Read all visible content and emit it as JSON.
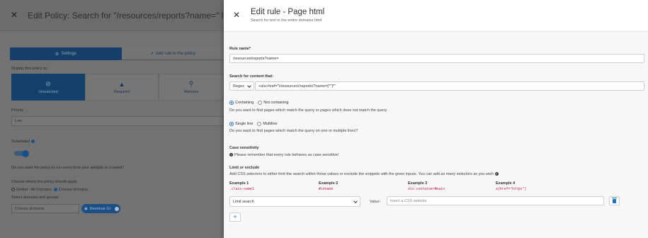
{
  "background": {
    "title": "Edit Policy: Search for \"/resources/reports?name=\" link",
    "tabs": {
      "settings": "Settings",
      "add_rule": "Add rule to the policy"
    },
    "display_label": "Display this policy as",
    "display_options": [
      "Unwatched",
      "Required",
      "Matches"
    ],
    "priority_label": "Priority",
    "priority_value": "Low",
    "scheduled_label": "Scheduled",
    "scheduled_help": "Do you want the policy to run every time your website is crawled?",
    "where_label": "Choose where the policy should apply",
    "where_options": [
      "Global - All Domains",
      "Choose domains"
    ],
    "domains_label": "Select domains and groups",
    "domains_placeholder": "Choose domains",
    "chip_label": "Revenue Gr"
  },
  "drawer": {
    "title": "Edit rule - Page html",
    "subtitle": "Search for text in the entire domains html",
    "rule_name_label": "Rule name*",
    "rule_name_value": "/resources/reports?name=",
    "search_label": "Search for content that:",
    "search_mode": "Regex",
    "search_value": "<a\\s+href=\"\\/resources\\/reports\\?name=[^\"]*\"",
    "contain_options": [
      "Containing",
      "Not containing"
    ],
    "contain_help": "Do you want to find pages which match the query or pages which does not match the query",
    "line_options": [
      "Single line",
      "Multiline"
    ],
    "line_help": "Do you want to find pages which match the query on one or multiple lines?",
    "case_label": "Case sensitivity",
    "case_note": "Please remember that every rule behaves as case-sensitive!",
    "limit_label": "Limit or exclude",
    "limit_help": "Add CSS selectors to either limit the search within those values or exclude the snippets with the given inputs. You can add as many selectors as you wish",
    "examples": [
      {
        "title": "Example 1",
        "code": ".class-name1"
      },
      {
        "title": "Example 2",
        "code": "#idname"
      },
      {
        "title": "Example 3",
        "code": "div.container#main"
      },
      {
        "title": "Example 4",
        "code": "a[href=\"https\"]"
      }
    ],
    "limit_select": "Limit search",
    "value_label": "Value:",
    "value_placeholder": "Insert a CSS selector",
    "add_label": "+"
  },
  "colors": {
    "accent": "#1e73be",
    "code": "#c7254e",
    "overlay_active": "#14406c"
  },
  "icons": [
    "close-icon",
    "gear-icon",
    "mouse-pointer-icon",
    "ban-icon",
    "warning-icon",
    "search-icon",
    "info-icon",
    "trash-icon",
    "plus-icon",
    "chevron-down-icon",
    "help-icon"
  ]
}
